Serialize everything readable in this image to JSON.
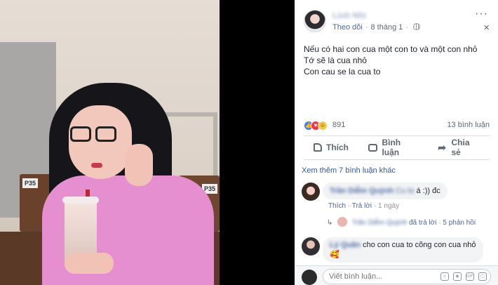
{
  "post": {
    "author": "Linh Nhi",
    "follow": "Theo dõi",
    "date": "8 tháng 1",
    "more_icon": "···",
    "close_icon": "×",
    "text_lines": [
      "Nếu có hai con cua một con to và một con nhỏ",
      "Tớ sẽ là cua nhỏ",
      "Con cau se la cua to"
    ]
  },
  "stats": {
    "reaction_count": "891",
    "comment_count": "13 bình luận"
  },
  "actions": {
    "like": "Thích",
    "comment": "Bình luận",
    "share": "Chia sẻ"
  },
  "comments": {
    "more": "Xem thêm 7 bình luận khác",
    "c1": {
      "name": "Trần Diễm Quỳnh",
      "tag": "Cu to",
      "text": "á :)) đc",
      "like": "Thích",
      "reply": "Trả lời",
      "time": "1 ngày",
      "reply_name": "Trần Diễm Quỳnh",
      "replied": "đã trả lời",
      "reply_count": "5 phản hồi"
    },
    "c2": {
      "name": "Lý Quân",
      "text": "cho con cua to cõng con cua nhỏ",
      "emoji": "🥰"
    }
  },
  "composer": {
    "placeholder": "Viết bình luận..."
  },
  "colors": {
    "link": "#385898",
    "like_reaction": "#4a7bea",
    "love_reaction": "#f0374b",
    "haha_reaction": "#f7c94b"
  }
}
